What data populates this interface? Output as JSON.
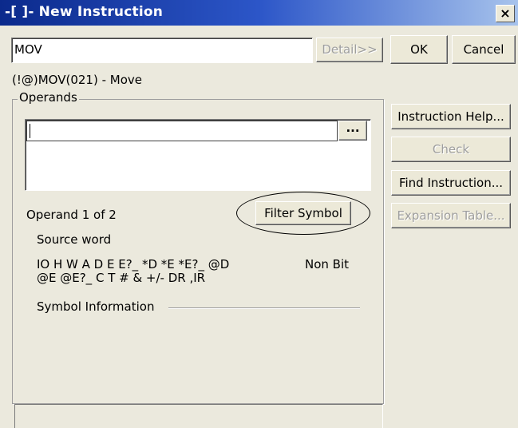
{
  "window": {
    "title": "-[ ]- New Instruction",
    "close_glyph": "×"
  },
  "instruction_input": {
    "value": "MOV"
  },
  "buttons": {
    "detail": "Detail>>",
    "ok": "OK",
    "cancel": "Cancel",
    "browse": "...",
    "filter_symbol": "Filter Symbol",
    "instruction_help": "Instruction Help...",
    "check": "Check",
    "find_instruction": "Find Instruction...",
    "expansion_table": "Expansion Table..."
  },
  "instruction_description": "(!@)MOV(021) - Move",
  "operands": {
    "legend": "Operands",
    "operand_counter": "Operand 1 of 2",
    "operand_name": "Source word",
    "allowed_types_line1": "IO H W A D E E?_ *D *E *E?_ @D",
    "allowed_types_line2": "@E @E?_ C T # & +/- DR ,IR",
    "bit_type": "Non Bit",
    "symbol_information_label": "Symbol Information"
  },
  "status_bar": {
    "text": ""
  },
  "icons": {
    "close": "close-icon",
    "browse": "ellipsis-icon"
  }
}
